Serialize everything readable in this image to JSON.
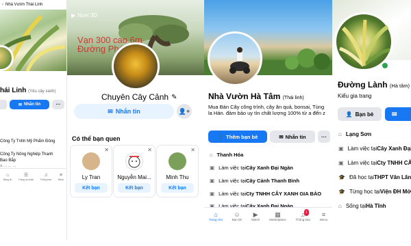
{
  "p1": {
    "topbar_title": "Nhà Vườn Thái Linh",
    "name": "hái Linh",
    "alt_name": "(Yêu cây xanh)",
    "message_label": "Nhắn tin",
    "more_label": "···",
    "lines": [
      "Công Ty Tnhh Mỹ Phẩm Đông",
      "Công Ty Nông Nghiệp Thanh",
      "Bao Bắp",
      "a ... ... ..."
    ],
    "nav": [
      {
        "icon": "⌂",
        "label": "Bảng tin"
      },
      {
        "icon": "☰",
        "label": "Trang cá nhân"
      },
      {
        "icon": "♫",
        "label": "Thông báo"
      },
      {
        "icon": "≡",
        "label": "Menu"
      }
    ]
  },
  "p2": {
    "noel_label": "Noel 3D",
    "cover_text_1": "Vạn 300 cao 6m",
    "cover_text_2": "Đường Phát...",
    "page_title": "Chuyên Cây Cảnh",
    "message_label": "Nhắn tin",
    "pymk_title": "Có thể bạn quen",
    "cards": [
      {
        "name": "Ly Tran",
        "button": "Kết bạn",
        "color": "#d7b48a"
      },
      {
        "name": "Nguyễn Mai...",
        "button": "Kết bạn",
        "color": "#ffffff"
      },
      {
        "name": "Minh Thu",
        "button": "Kết bạn",
        "color": "#7aa05a"
      }
    ]
  },
  "p3": {
    "name": "Nhà Vườn Hà Tâm",
    "alt_name": "(Thái linh)",
    "bio": "Mua Bán Cây công trình, cây ăn quả, bonsai, Tùng la Hán. đảm bảo uy tín chất lượng 100% từ a đến z",
    "add_friend_label": "Thêm bạn bè",
    "message_label": "Nhắn tin",
    "more_label": "···",
    "info": [
      {
        "prefix": "",
        "bold": "Thanh Hóa"
      },
      {
        "prefix": "Làm việc tại ",
        "bold": "Cây Xanh Đại Ngàn"
      },
      {
        "prefix": "Làm việc tại ",
        "bold": "Cây Cảnh Thanh Bình"
      },
      {
        "prefix": "Làm việc tại ",
        "bold": "Cty TNHH CÂY XANH GIA BẢO"
      },
      {
        "prefix": "Làm việc tại ",
        "bold": "Cây Xanh Đại Ngàn"
      }
    ],
    "nav": [
      {
        "icon": "⌂",
        "label": "Trang chủ"
      },
      {
        "icon": "☺",
        "label": "Bạn bè"
      },
      {
        "icon": "▶",
        "label": "Watch"
      },
      {
        "icon": "▦",
        "label": "Marketplace"
      },
      {
        "icon": "♫",
        "label": "Thông báo",
        "badge": "1"
      },
      {
        "icon": "≡",
        "label": "Menu"
      }
    ],
    "accent": "#1877f2"
  },
  "p4": {
    "name": "Đường Lành",
    "alt_name": "(Hà tâm)",
    "bio": "Kiểu gia trang",
    "friend_label": "Bạn bè",
    "info": [
      {
        "prefix": "",
        "bold": "Lạng Sơn"
      },
      {
        "prefix": "Làm việc tại ",
        "bold": "Cây Xanh Đại Ngàn"
      },
      {
        "prefix": "Làm việc tại ",
        "bold": "Cty TNHH CÂY XANH"
      },
      {
        "prefix": "Đã học tại ",
        "bold": "THPT Văn Lãng"
      },
      {
        "prefix": "Từng học tại ",
        "bold": "Viện ĐH Mở"
      },
      {
        "prefix": "Sống tại ",
        "bold": "Hà Tĩnh"
      }
    ]
  }
}
